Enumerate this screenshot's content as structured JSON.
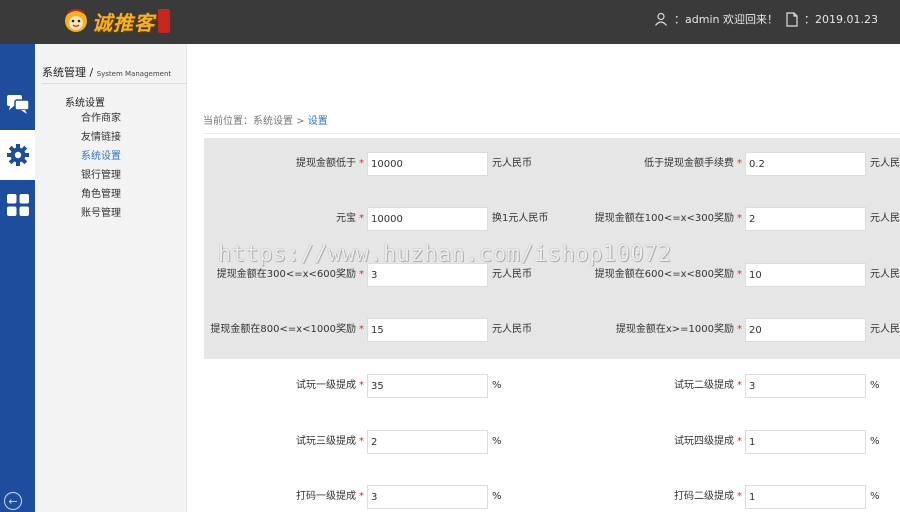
{
  "header": {
    "logo_text": "诚推客",
    "user_text": "：admin 欢迎回来！",
    "date_text": "：2019.01.23"
  },
  "sidebar": {
    "title": "系统管理",
    "title_sep": " / ",
    "title_en": "System Management",
    "group": "系统设置",
    "items": [
      {
        "label": "合作商家"
      },
      {
        "label": "友情链接"
      },
      {
        "label": "系统设置"
      },
      {
        "label": "银行管理"
      },
      {
        "label": "角色管理"
      },
      {
        "label": "账号管理"
      }
    ],
    "active_index": 2
  },
  "breadcrumb": {
    "prefix": "当前位置：系统设置 > ",
    "current": "设置"
  },
  "form": {
    "rows": [
      {
        "left": {
          "label": "提现金额低于",
          "value": "10000",
          "unit": "元人民币"
        },
        "right": {
          "label": "低于提现金额手续费",
          "value": "0.2",
          "unit": "元人民币"
        }
      },
      {
        "left": {
          "label": "元宝",
          "value": "10000",
          "unit": "换1元人民币"
        },
        "right": {
          "label": "提现金额在100<=x<300奖励",
          "value": "2",
          "unit": "元人民币"
        }
      },
      {
        "left": {
          "label": "提现金额在300<=x<600奖励",
          "value": "3",
          "unit": "元人民币"
        },
        "right": {
          "label": "提现金额在600<=x<800奖励",
          "value": "10",
          "unit": "元人民币"
        }
      },
      {
        "left": {
          "label": "提现金额在800<=x<1000奖励",
          "value": "15",
          "unit": "元人民币"
        },
        "right": {
          "label": "提现金额在x>=1000奖励",
          "value": "20",
          "unit": "元人民币"
        }
      },
      {
        "left": {
          "label": "试玩一级提成",
          "value": "35",
          "unit": "%"
        },
        "right": {
          "label": "试玩二级提成",
          "value": "3",
          "unit": "%"
        }
      },
      {
        "left": {
          "label": "试玩三级提成",
          "value": "2",
          "unit": "%"
        },
        "right": {
          "label": "试玩四级提成",
          "value": "1",
          "unit": "%"
        }
      },
      {
        "left": {
          "label": "打码一级提成",
          "value": "3",
          "unit": "%"
        },
        "right": {
          "label": "打码二级提成",
          "value": "1",
          "unit": "%"
        }
      }
    ],
    "required_mark": "*"
  },
  "watermark": "https://www.huzhan.com/ishop10072",
  "colors": {
    "topbar": "#3a3a3a",
    "rail": "#1d4d9c",
    "accent": "#3273c8",
    "required": "#d9302a",
    "panel": "#e6e6e6"
  },
  "icons": {
    "rail": [
      "chat-icon",
      "gear-icon",
      "grid-icon"
    ],
    "header": [
      "user-icon",
      "document-icon"
    ],
    "back": "back-arrow-icon"
  }
}
